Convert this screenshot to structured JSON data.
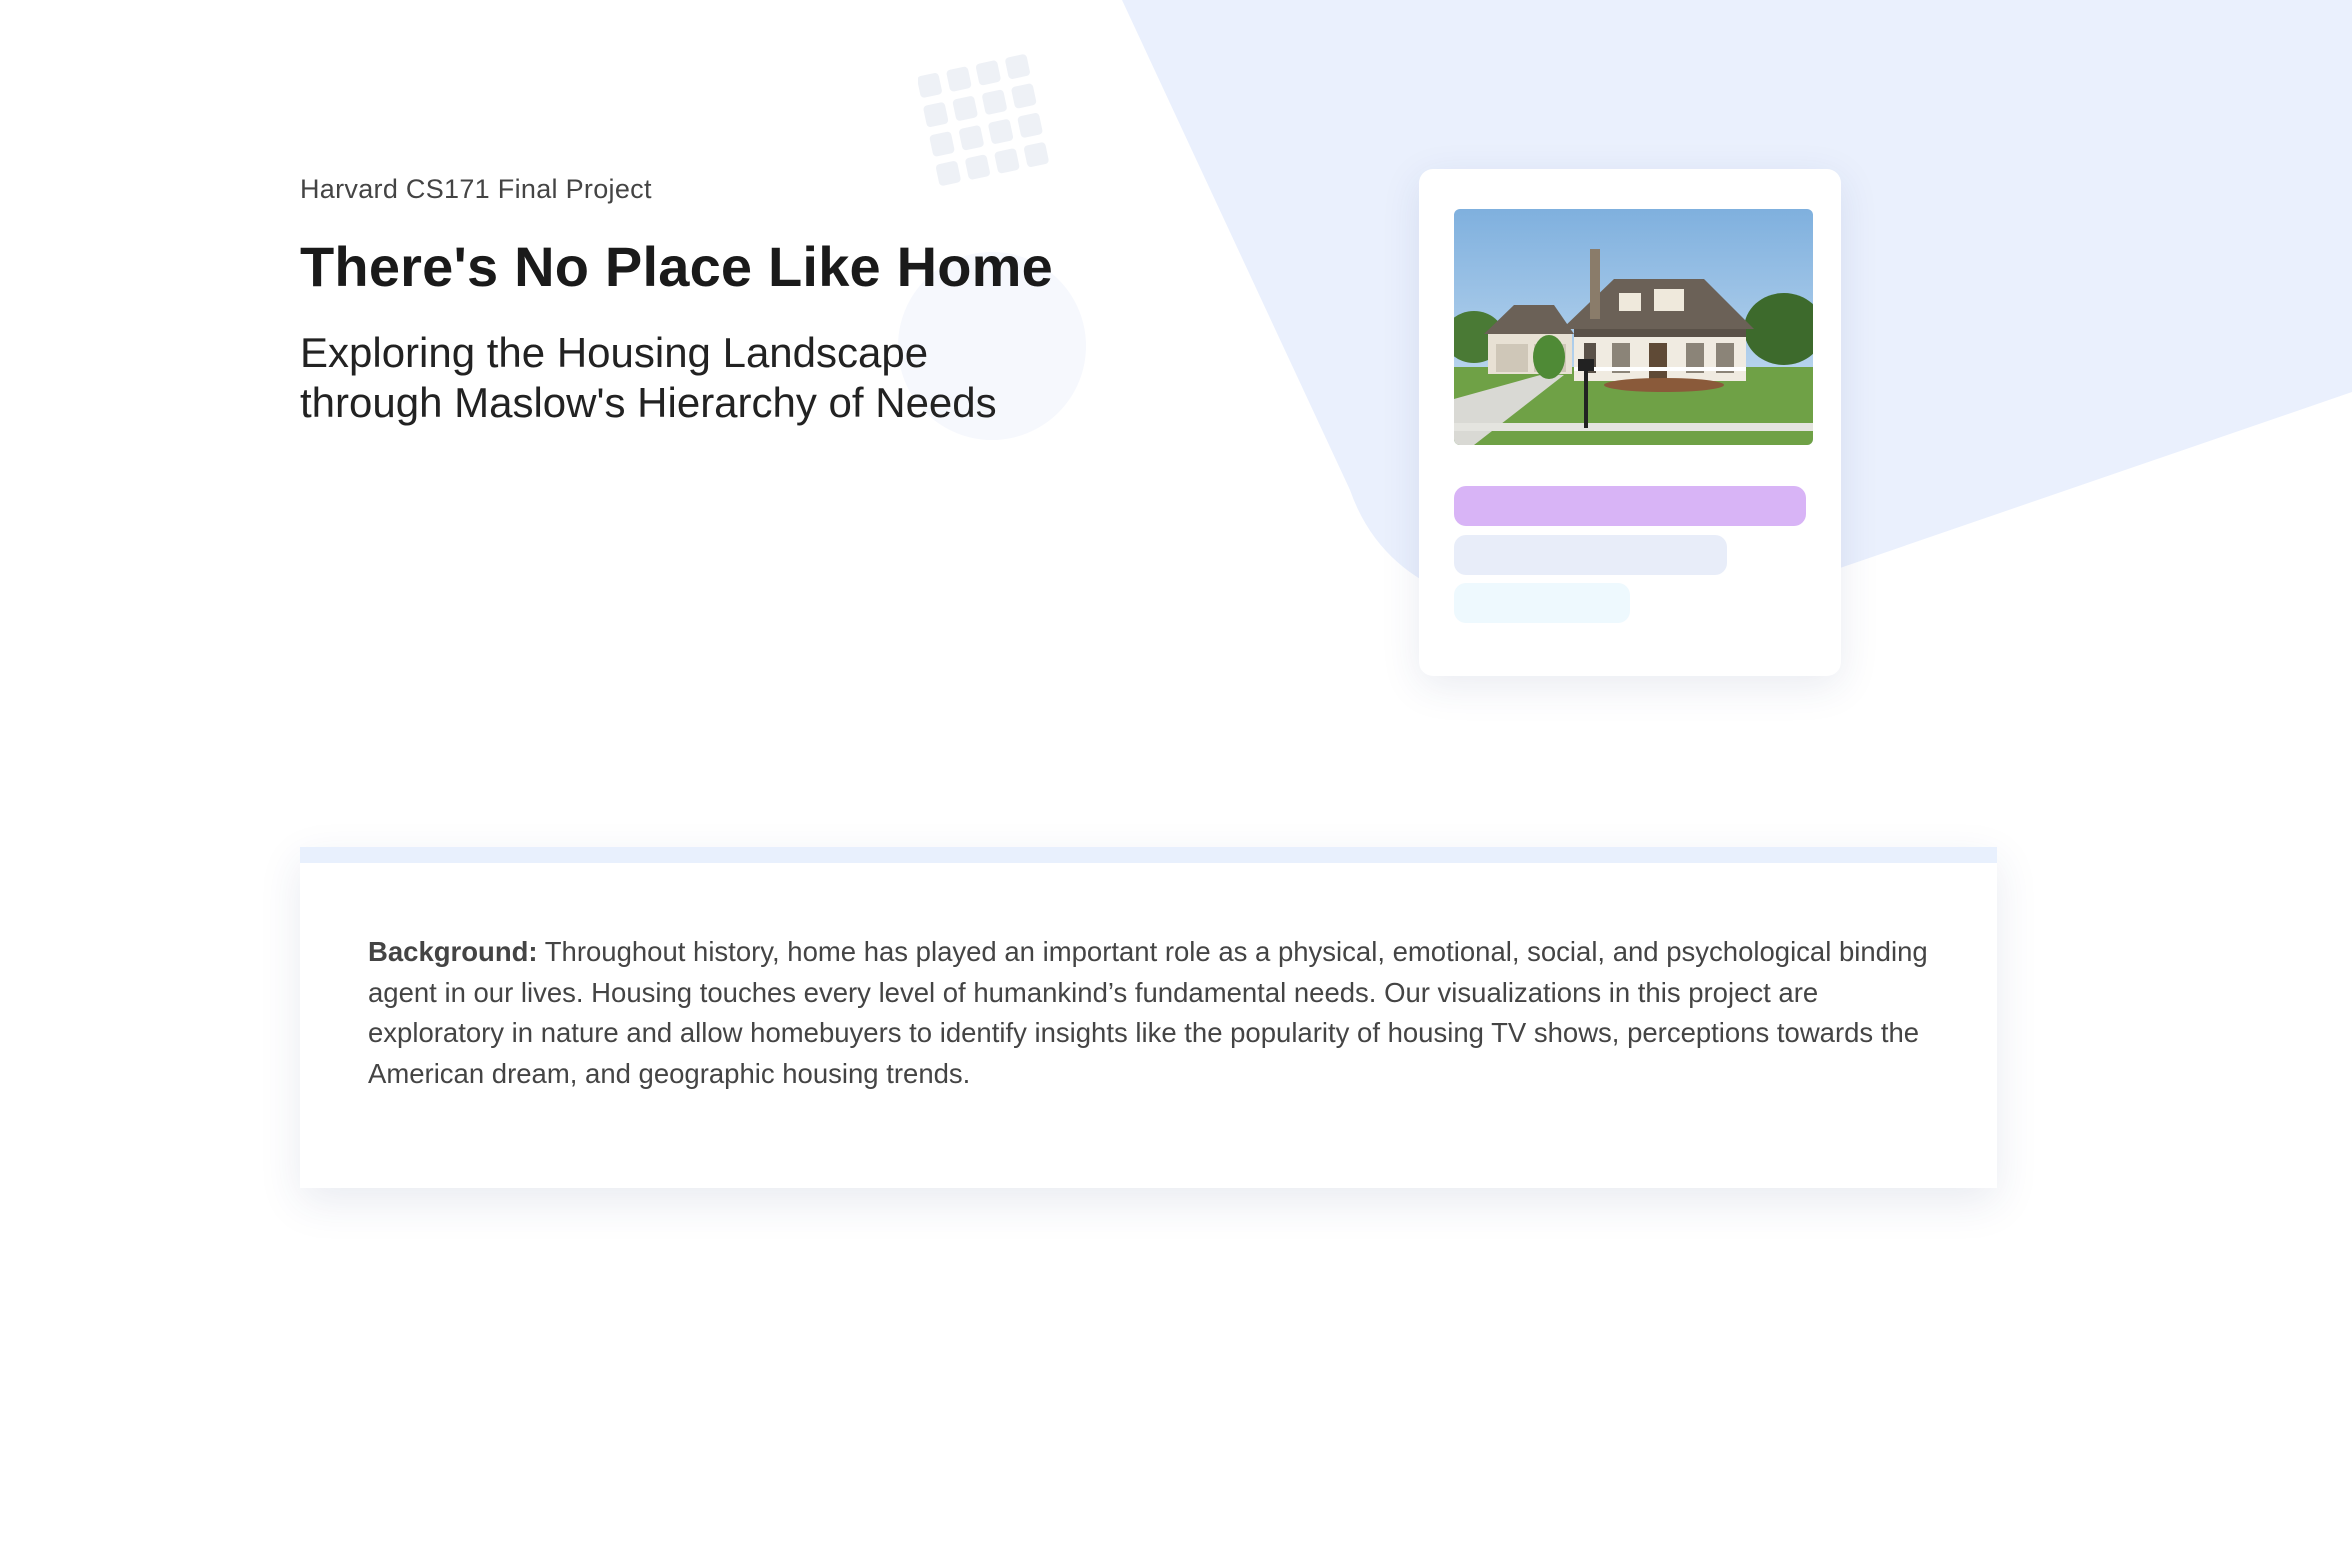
{
  "hero": {
    "eyebrow": "Harvard CS171 Final Project",
    "title": "There's No Place Like Home",
    "subtitle": "Exploring the Housing Landscape through Maslow's Hierarchy of Needs"
  },
  "card": {
    "image_icon": "house-photo",
    "bar_colors": [
      "#d8b4f6",
      "#e8edf9",
      "#eef9fe"
    ]
  },
  "background_panel": {
    "label": "Background:",
    "text": " Throughout history, home has played an important role as a physical, emotional, social, and psychological binding agent in our lives. Housing touches every level of humankind’s fundamental needs. Our visualizations in this project are exploratory in nature and allow homebuyers to identify insights like the popularity of housing TV shows, perceptions towards the American dream, and geographic housing trends.",
    "accent_color": "#e8f0fd"
  },
  "colors": {
    "bg_shape": "#eaf0fd",
    "dot_grid": "#eef1f6",
    "circle": "#f6f8fd"
  }
}
